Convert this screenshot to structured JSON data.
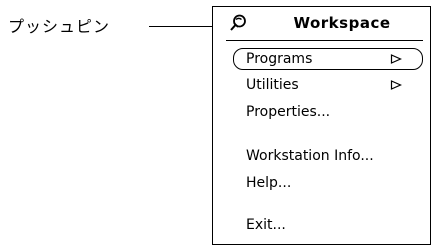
{
  "callout": {
    "label": "プッシュピン"
  },
  "menu": {
    "title": "Workspace",
    "pin_icon": "pushpin-icon",
    "items": [
      {
        "label": "Programs",
        "submenu": true,
        "default": true
      },
      {
        "label": "Utilities",
        "submenu": true,
        "default": false
      },
      {
        "label": "Properties...",
        "submenu": false,
        "default": false
      },
      {
        "label": "Workstation Info...",
        "submenu": false,
        "default": false
      },
      {
        "label": "Help...",
        "submenu": false,
        "default": false
      },
      {
        "label": "Exit...",
        "submenu": false,
        "default": false
      }
    ],
    "submenu_icon": "submenu-arrow-icon"
  }
}
